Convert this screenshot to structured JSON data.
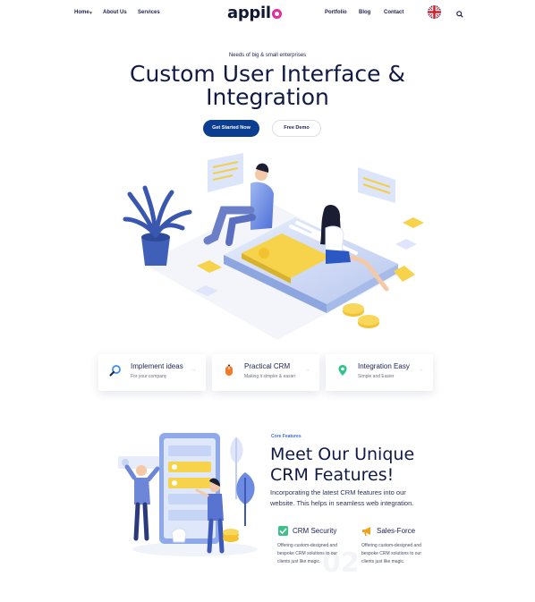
{
  "nav": {
    "logo": "appil",
    "links": [
      "Home",
      "About Us",
      "Services",
      "Portfolio",
      "Blog",
      "Contact"
    ]
  },
  "hero": {
    "eyebrow": "Needs of big & small enterprises",
    "title_line1": "Custom User Interface &",
    "title_line2": "Integration",
    "primary_button": "Get Started Now",
    "secondary_button": "Free Demo"
  },
  "cards": [
    {
      "title": "Implement ideas",
      "subtitle": "For your company",
      "icon": "magnifier-icon"
    },
    {
      "title": "Practical CRM",
      "subtitle": "Making it simpler & easier",
      "icon": "mouse-icon"
    },
    {
      "title": "Integration Easy",
      "subtitle": "Simple and Easier",
      "icon": "location-pin-icon"
    }
  ],
  "features": {
    "eyebrow": "Core Features",
    "title_line1": "Meet Our Unique",
    "title_line2": "CRM Features!",
    "description": "Incorporating the latest CRM features into our website. This helps in seamless web integration.",
    "items": [
      {
        "title": "CRM Security",
        "text": "Offering custom-designed and bespoke CRM solutions to our clients just like magic.",
        "icon": "security-icon"
      },
      {
        "title": "Sales-Force",
        "text": "Offering custom-designed and bespoke CRM solutions to our clients just like magic.",
        "icon": "megaphone-icon"
      }
    ],
    "watermark": "02"
  },
  "colors": {
    "brand_dark": "#111a44",
    "primary_button": "#0b3d91",
    "logo_accent": "#e52aa0",
    "link_accent": "#3d6fe0"
  }
}
